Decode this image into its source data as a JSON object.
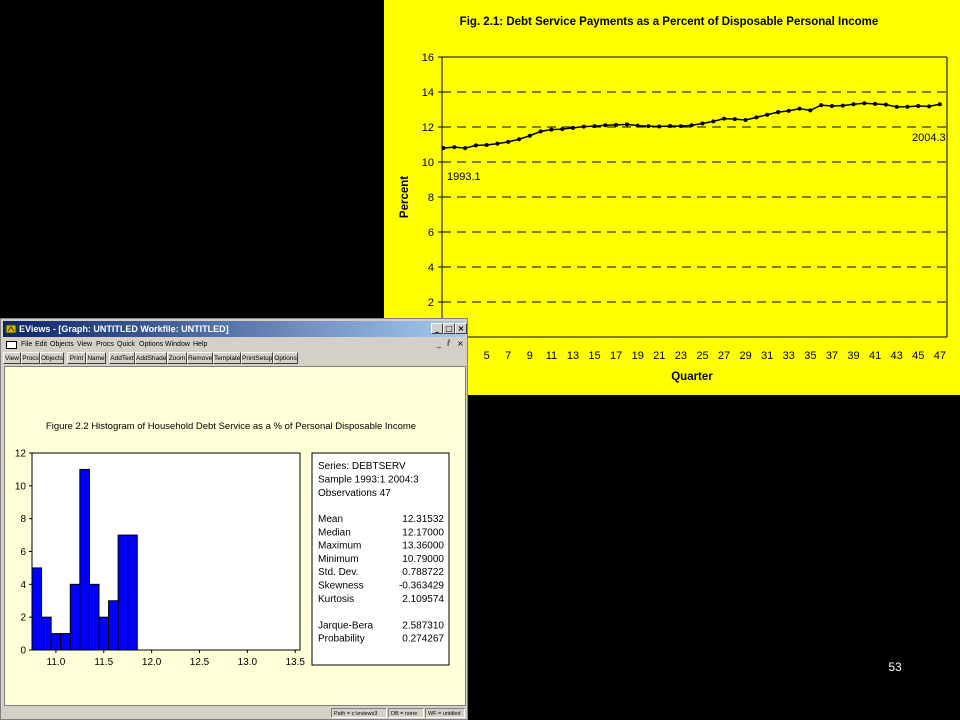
{
  "slide_number": "53",
  "colors": {
    "slide_bg": "#000000",
    "chart_bg": "#ffff00",
    "hist_bar": "#0000ff",
    "graph_bg": "#ffffd8",
    "titlebar": "#0a246a"
  },
  "window": {
    "title": "EViews - [Graph: UNTITLED   Workfile: UNTITLED]",
    "icon": "eviews-app-icon",
    "controls": [
      "_",
      "□",
      "×"
    ],
    "mdi_controls": [
      "_",
      "ř",
      "×"
    ],
    "menu": [
      "File",
      "Edit",
      "Objects",
      "View",
      "Procs",
      "Quick",
      "Options",
      "Window",
      "Help"
    ],
    "toolbar": [
      "View",
      "Procs",
      "Objects",
      "Print",
      "Name",
      "AddText",
      "AddShade",
      "Zoom",
      "Remove",
      "Template",
      "PrintSetup",
      "Options"
    ],
    "status": [
      "Path = c:\\eviews3",
      "DB = none",
      "WF = untitled"
    ]
  },
  "chart_data": [
    {
      "type": "line",
      "title": "Fig. 2.1: Debt Service Payments as a Percent of Disposable Personal Income",
      "xlabel": "Quarter",
      "ylabel": "Percent",
      "ylim": [
        0,
        16
      ],
      "yticks": [
        2,
        4,
        6,
        8,
        10,
        12,
        14,
        16
      ],
      "xticks_visible": [
        5,
        7,
        9,
        11,
        13,
        15,
        17,
        19,
        21,
        23,
        25,
        27,
        29,
        31,
        33,
        35,
        37,
        39,
        41,
        43,
        45,
        47
      ],
      "grid": "horizontal dashed",
      "annotations": [
        {
          "text": "1993.1",
          "x": 1,
          "y": 10.8
        },
        {
          "text": "2004.3",
          "x": 47,
          "y": 13.3
        }
      ],
      "x": [
        1,
        2,
        3,
        4,
        5,
        6,
        7,
        8,
        9,
        10,
        11,
        12,
        13,
        14,
        15,
        16,
        17,
        18,
        19,
        20,
        21,
        22,
        23,
        24,
        25,
        26,
        27,
        28,
        29,
        30,
        31,
        32,
        33,
        34,
        35,
        36,
        37,
        38,
        39,
        40,
        41,
        42,
        43,
        44,
        45,
        46,
        47
      ],
      "series": [
        {
          "values": [
            10.8,
            10.85,
            10.79,
            10.95,
            10.97,
            11.05,
            11.15,
            11.3,
            11.5,
            11.75,
            11.85,
            11.88,
            11.95,
            12.02,
            12.05,
            12.1,
            12.12,
            12.15,
            12.08,
            12.05,
            12.03,
            12.06,
            12.05,
            12.1,
            12.2,
            12.32,
            12.48,
            12.45,
            12.4,
            12.55,
            12.7,
            12.85,
            12.92,
            13.05,
            12.95,
            13.25,
            13.2,
            13.22,
            13.3,
            13.36,
            13.32,
            13.28,
            13.15,
            13.16,
            13.2,
            13.18,
            13.3,
            13.31
          ]
        }
      ]
    },
    {
      "type": "bar",
      "title": "Figure 2.2 Histogram of Household Debt Service as a % of Personal Disposable Income",
      "xlabel": "",
      "ylabel": "",
      "ylim": [
        0,
        12
      ],
      "yticks": [
        0,
        2,
        4,
        6,
        8,
        10,
        12
      ],
      "xlim": [
        10.75,
        13.55
      ],
      "xticks": [
        "11.0",
        "11.5",
        "12.0",
        "12.5",
        "13.0",
        "13.5"
      ],
      "bins": [
        {
          "from": 10.75,
          "to": 10.85,
          "count": 5
        },
        {
          "from": 10.85,
          "to": 10.95,
          "count": 2
        },
        {
          "from": 10.95,
          "to": 11.05,
          "count": 1
        },
        {
          "from": 11.05,
          "to": 11.15,
          "count": 1
        },
        {
          "from": 11.15,
          "to": 11.25,
          "count": 4
        },
        {
          "from": 11.25,
          "to": 11.35,
          "count": 11
        },
        {
          "from": 11.35,
          "to": 11.45,
          "count": 4
        },
        {
          "from": 11.45,
          "to": 11.55,
          "count": 2
        },
        {
          "from": 11.55,
          "to": 11.65,
          "count": 3
        },
        {
          "from": 11.65,
          "to": 11.75,
          "count": 7
        },
        {
          "from": 11.75,
          "to": 11.85,
          "count": 7
        }
      ],
      "stats": {
        "header": [
          "Series: DEBTSERV",
          "Sample 1993:1 2004:3",
          "Observations 47"
        ],
        "rows": [
          [
            "Mean",
            "12.31532"
          ],
          [
            "Median",
            "12.17000"
          ],
          [
            "Maximum",
            "13.36000"
          ],
          [
            "Minimum",
            "10.79000"
          ],
          [
            "Std. Dev.",
            "0.788722"
          ],
          [
            "Skewness",
            "-0.363429"
          ],
          [
            "Kurtosis",
            "2.109574"
          ],
          [
            "",
            ""
          ],
          [
            "Jarque-Bera",
            "2.587310"
          ],
          [
            "Probability",
            "0.274267"
          ]
        ]
      }
    }
  ]
}
